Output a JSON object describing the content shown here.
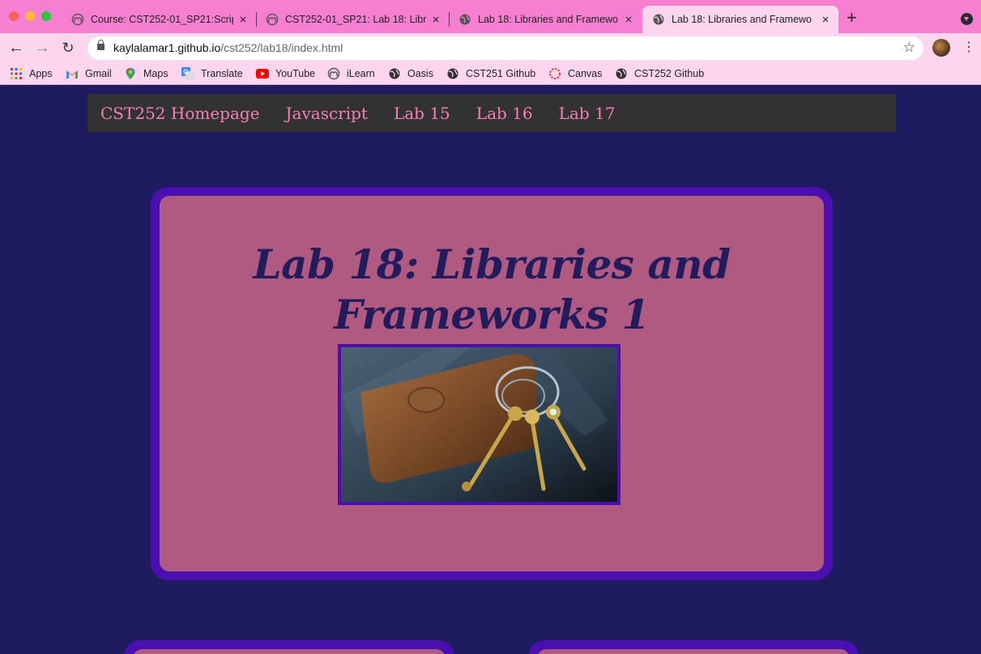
{
  "browser": {
    "tabs": [
      {
        "title": "Course: CST252-01_SP21:Scrip",
        "icon": "moodle-icon",
        "active": false
      },
      {
        "title": "CST252-01_SP21: Lab 18: Libra",
        "icon": "moodle-icon",
        "active": false
      },
      {
        "title": "Lab 18: Libraries and Framewo",
        "icon": "globe-icon",
        "active": false
      },
      {
        "title": "Lab 18: Libraries and Framewo",
        "icon": "globe-icon",
        "active": true
      }
    ],
    "tab_close_glyph": "×",
    "new_tab_glyph": "+",
    "url_host": "kaylalamar1.github.io",
    "url_path": "/cst252/lab18/index.html",
    "bookmarks": [
      {
        "label": "Apps",
        "icon": "apps-grid-icon"
      },
      {
        "label": "Gmail",
        "icon": "gmail-icon"
      },
      {
        "label": "Maps",
        "icon": "maps-pin-icon"
      },
      {
        "label": "Translate",
        "icon": "translate-icon"
      },
      {
        "label": "YouTube",
        "icon": "youtube-icon"
      },
      {
        "label": "iLearn",
        "icon": "moodle-icon"
      },
      {
        "label": "Oasis",
        "icon": "globe-icon"
      },
      {
        "label": "CST251 Github",
        "icon": "globe-icon"
      },
      {
        "label": "Canvas",
        "icon": "canvas-icon"
      },
      {
        "label": "CST252 Github",
        "icon": "globe-icon"
      }
    ]
  },
  "site_nav": {
    "items": [
      "CST252 Homepage",
      "Javascript",
      "Lab 15",
      "Lab 16",
      "Lab 17"
    ]
  },
  "main": {
    "title": "Lab 18: Libraries and Frameworks 1",
    "image_subject": "keys-ring-pouch-image"
  },
  "colors": {
    "tabstrip": "#f77fd1",
    "toolbar": "#fcd6ee",
    "page_bg": "#1e1b5e",
    "nav_bg": "#323232",
    "nav_link": "#f77fb5",
    "card_border": "#4a0fb0",
    "card_fill": "#b05a82",
    "title": "#231c5c"
  }
}
